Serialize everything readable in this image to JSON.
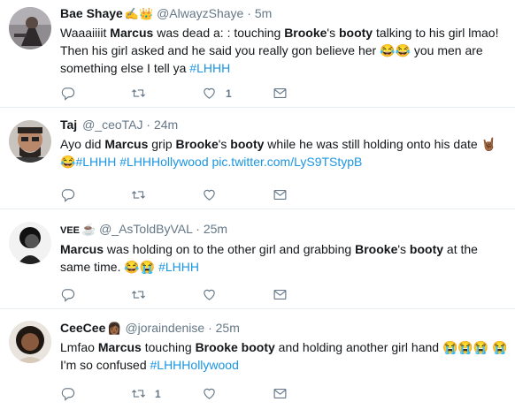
{
  "tweets": [
    {
      "name": "Bae Shaye",
      "badges": "✍️👑",
      "handle": "@AlwayzShaye",
      "time": "5m",
      "segments": [
        {
          "t": "Waaaiiiit "
        },
        {
          "t": "Marcus",
          "b": true
        },
        {
          "t": " was dead a: : touching "
        },
        {
          "t": "Brooke",
          "b": true
        },
        {
          "t": "'s "
        },
        {
          "t": "booty",
          "b": true
        },
        {
          "t": " talking to his girl lmao! Then his girl asked and he said you really gon believe her 😂😂 you men are something else I tell ya "
        },
        {
          "t": "#LHHH",
          "tag": true
        }
      ],
      "reply_count": "",
      "retweet_count": "",
      "like_count": "1"
    },
    {
      "name": "Taj",
      "badges": "",
      "handle": "@_ceoTAJ",
      "time": "24m",
      "segments": [
        {
          "t": "Ayo did "
        },
        {
          "t": "Marcus",
          "b": true
        },
        {
          "t": " grip "
        },
        {
          "t": "Brooke",
          "b": true
        },
        {
          "t": "'s "
        },
        {
          "t": "booty",
          "b": true
        },
        {
          "t": " while he was still holding onto his date 🤘🏾 😂"
        },
        {
          "t": "#LHHH",
          "tag": true
        },
        {
          "t": " "
        },
        {
          "t": "#LHHHollywood",
          "tag": true
        },
        {
          "t": " "
        },
        {
          "t": "pic.twitter.com/LyS9TStypB",
          "tag": true
        }
      ],
      "reply_count": "",
      "retweet_count": "",
      "like_count": ""
    },
    {
      "name": "VEE",
      "badges": "☕",
      "handle": "@_AsToldByVAL",
      "time": "25m",
      "segments": [
        {
          "t": "Marcus",
          "b": true
        },
        {
          "t": " was holding on to the other girl and grabbing "
        },
        {
          "t": "Brooke",
          "b": true
        },
        {
          "t": "'s "
        },
        {
          "t": "booty",
          "b": true
        },
        {
          "t": " at the same time. 😂😭 "
        },
        {
          "t": "#LHHH",
          "tag": true
        }
      ],
      "reply_count": "",
      "retweet_count": "",
      "like_count": ""
    },
    {
      "name": "CeeCee",
      "badges": "👩🏾",
      "handle": "@joraindenise",
      "time": "25m",
      "segments": [
        {
          "t": "Lmfao "
        },
        {
          "t": "Marcus",
          "b": true
        },
        {
          "t": " touching "
        },
        {
          "t": "Brooke booty",
          "b": true
        },
        {
          "t": " and holding another girl hand 😭😭😭 😭 I'm so confused "
        },
        {
          "t": "#LHHHollywood",
          "tag": true
        }
      ],
      "reply_count": "",
      "retweet_count": "1",
      "like_count": ""
    }
  ],
  "dot": "·",
  "icons": {
    "reply": "reply-icon",
    "retweet": "retweet-icon",
    "like": "heart-icon",
    "dm": "envelope-icon"
  },
  "colors": {
    "hashtag": "#1b95e0",
    "secondary": "#657786",
    "divider": "#e6ecf0"
  }
}
